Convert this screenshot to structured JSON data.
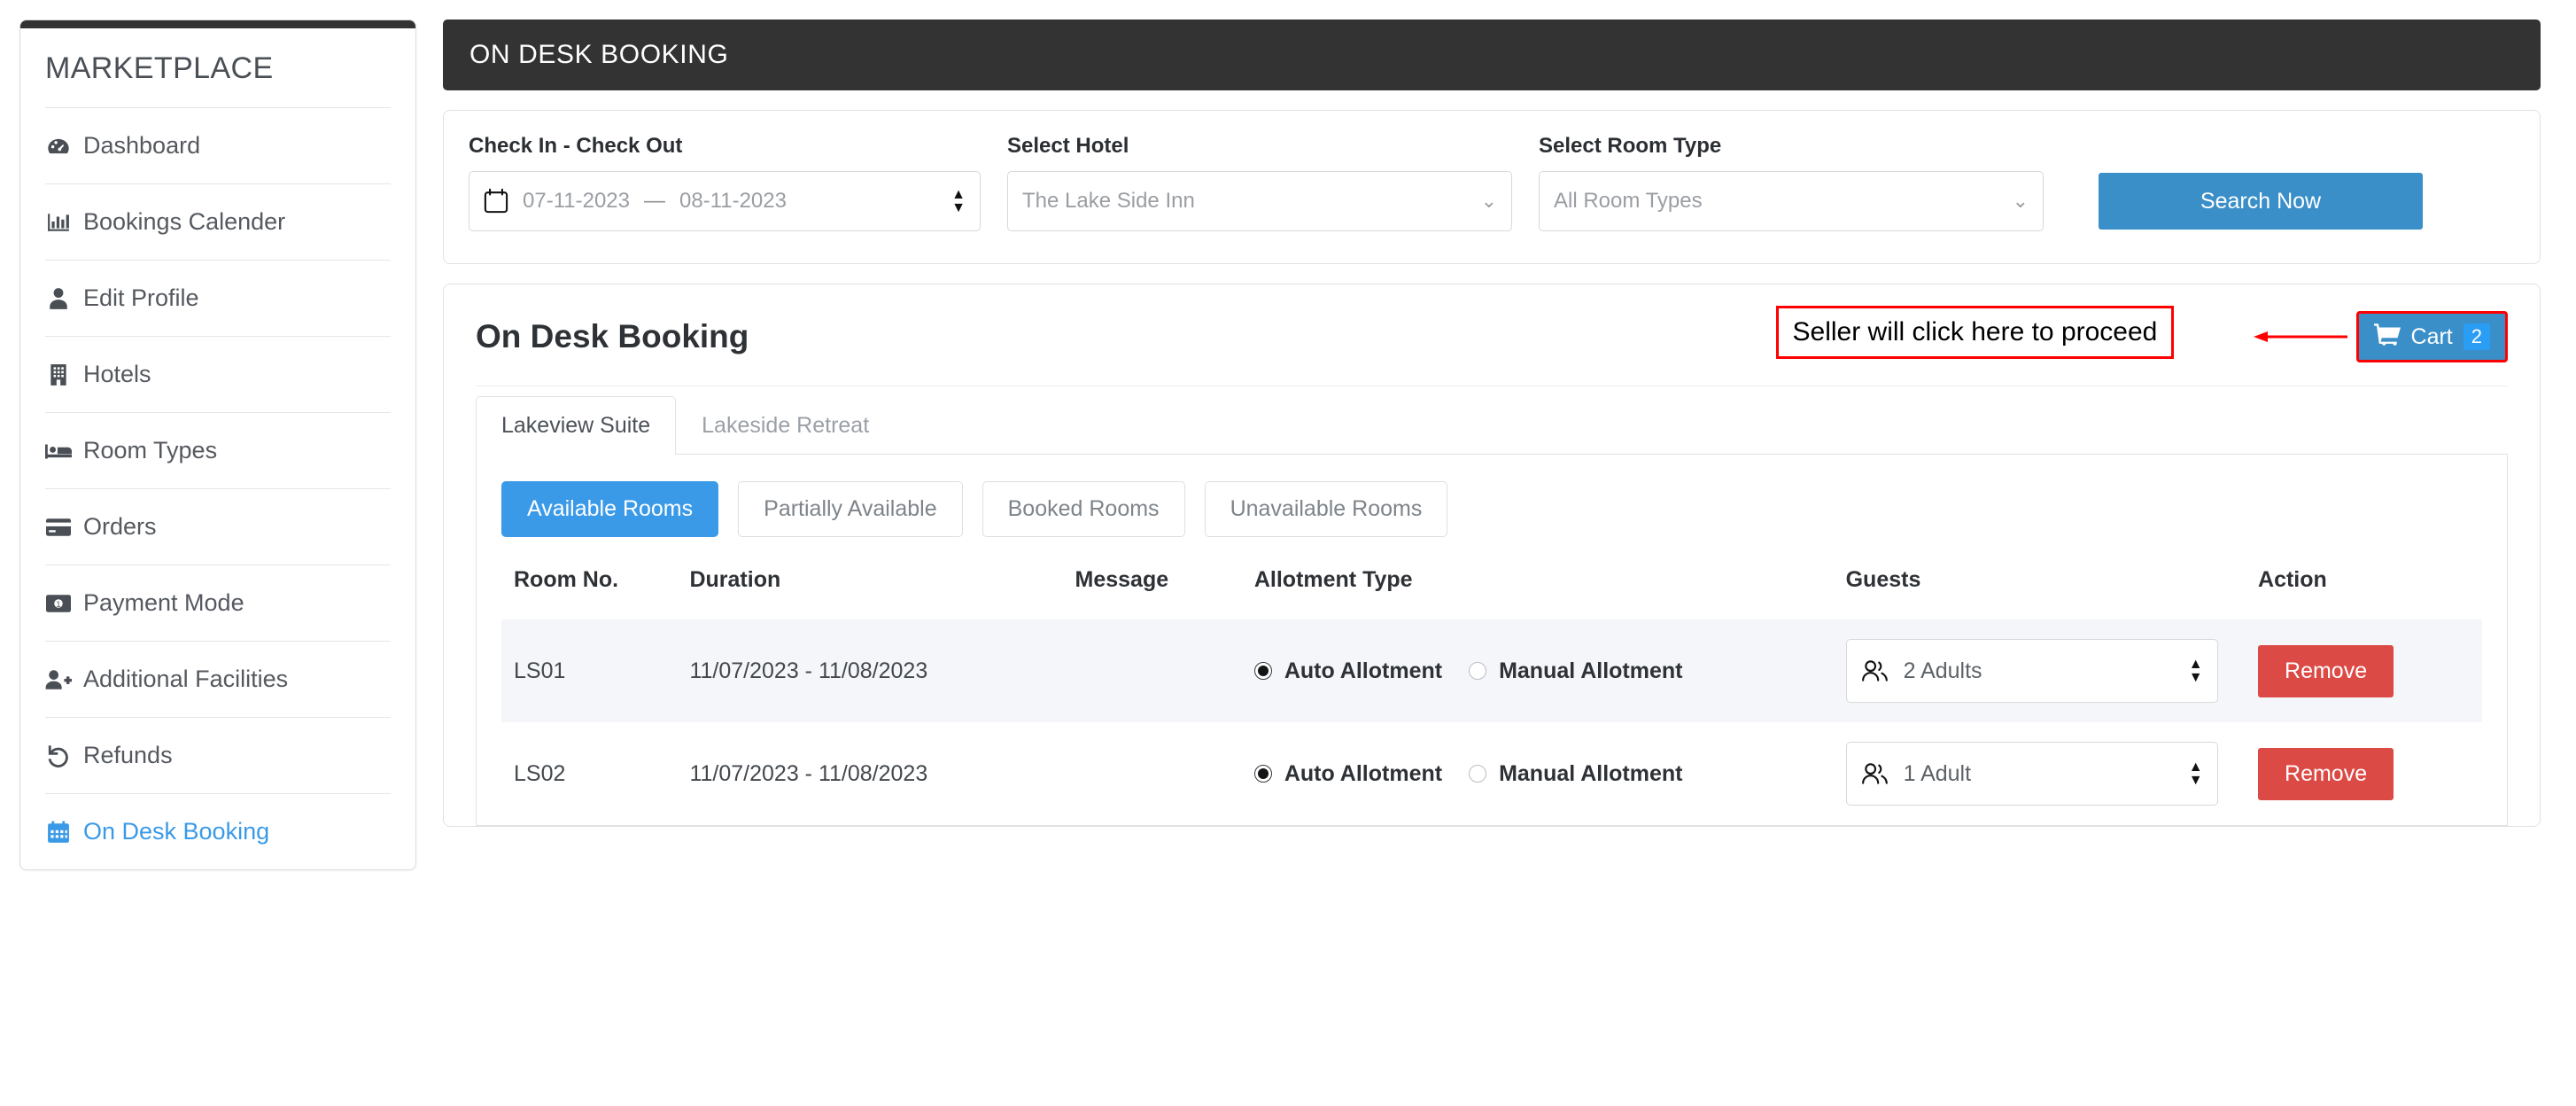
{
  "sidebar": {
    "brand": "MARKETPLACE",
    "items": [
      {
        "label": "Dashboard",
        "icon": "dashboard-icon",
        "active": false
      },
      {
        "label": "Bookings Calender",
        "icon": "bar-chart-icon",
        "active": false
      },
      {
        "label": "Edit Profile",
        "icon": "user-icon",
        "active": false
      },
      {
        "label": "Hotels",
        "icon": "building-icon",
        "active": false
      },
      {
        "label": "Room Types",
        "icon": "bed-icon",
        "active": false
      },
      {
        "label": "Orders",
        "icon": "credit-card-icon",
        "active": false
      },
      {
        "label": "Payment Mode",
        "icon": "money-bill-icon",
        "active": false
      },
      {
        "label": "Additional Facilities",
        "icon": "user-plus-icon",
        "active": false
      },
      {
        "label": "Refunds",
        "icon": "undo-icon",
        "active": false
      },
      {
        "label": "On Desk Booking",
        "icon": "calendar-icon",
        "active": true
      }
    ]
  },
  "topbar": {
    "title": "ON DESK BOOKING"
  },
  "filters": {
    "checkin_label": "Check In - Check Out",
    "checkin_value": "07-11-2023",
    "range_dash": "—",
    "checkout_value": "08-11-2023",
    "hotel_label": "Select Hotel",
    "hotel_value": "The Lake Side Inn",
    "roomtype_label": "Select Room Type",
    "roomtype_value": "All Room Types",
    "search_label": "Search Now"
  },
  "panel": {
    "title": "On Desk Booking",
    "cart_label": "Cart",
    "cart_count": "2",
    "annotation": "Seller will click here to proceed"
  },
  "tabs": [
    {
      "label": "Lakeview Suite",
      "active": true
    },
    {
      "label": "Lakeside Retreat",
      "active": false
    }
  ],
  "pills": [
    {
      "label": "Available Rooms",
      "active": true
    },
    {
      "label": "Partially Available",
      "active": false
    },
    {
      "label": "Booked Rooms",
      "active": false
    },
    {
      "label": "Unavailable Rooms",
      "active": false
    }
  ],
  "table": {
    "headers": [
      "Room No.",
      "Duration",
      "Message",
      "Allotment Type",
      "Guests",
      "Action"
    ],
    "auto_label": "Auto Allotment",
    "manual_label": "Manual Allotment",
    "remove_label": "Remove",
    "rows": [
      {
        "room_no": "LS01",
        "duration": "11/07/2023 - 11/08/2023",
        "message": "",
        "allotment": "auto",
        "guests": "2 Adults"
      },
      {
        "room_no": "LS02",
        "duration": "11/07/2023 - 11/08/2023",
        "message": "",
        "allotment": "auto",
        "guests": "1 Adult"
      }
    ]
  },
  "colors": {
    "accent_blue": "#3a8fc8",
    "pill_blue": "#3a9ae8",
    "danger_red": "#dc4a45",
    "annotation_red": "#fe0000",
    "header_dark": "#333333"
  }
}
